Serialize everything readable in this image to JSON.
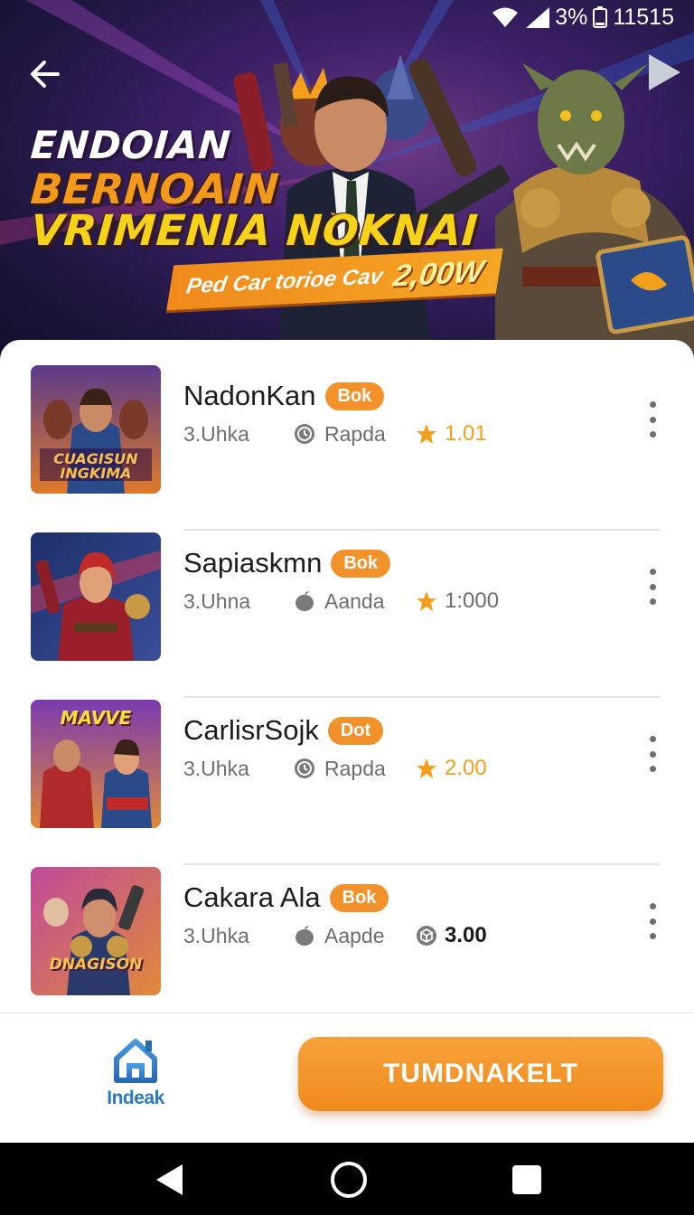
{
  "status_bar": {
    "battery": "3%",
    "time": "11515"
  },
  "header": {
    "back_icon": "arrow-left-icon"
  },
  "hero": {
    "line1": "ENDOIAN",
    "line2": "BERNOAIN",
    "line3": "VRIMENIA NOKNAI",
    "promo_text": "Ped Car torioe Cav",
    "promo_amount": "2,00W"
  },
  "games": [
    {
      "name": "NadonKan",
      "badge": "Bok",
      "meta_a": "3.Uhka",
      "meta_b": "Rapda",
      "meta_b_icon": "clock-icon",
      "rating": "1.01",
      "rating_icon": "star-icon",
      "thumb_text": "CUAGISUN INGKIMA"
    },
    {
      "name": "Sapiaskmn",
      "badge": "Bok",
      "meta_a": "3.Uhna",
      "meta_b": "Aanda",
      "meta_b_icon": "fruit-icon",
      "rating": "1:000",
      "rating_icon": "star-icon",
      "thumb_text": ""
    },
    {
      "name": "CarlisrSojk",
      "badge": "Dot",
      "meta_a": "3.Uhka",
      "meta_b": "Rapda",
      "meta_b_icon": "clock-icon",
      "rating": "2.00",
      "rating_icon": "star-icon",
      "thumb_text": "MAVVE"
    },
    {
      "name": "Cakara Ala",
      "badge": "Bok",
      "meta_a": "3.Uhka",
      "meta_b": "Aapde",
      "meta_b_icon": "fruit-icon",
      "rating": "3.00",
      "rating_icon": "cube-icon",
      "thumb_text": "DNAGISON"
    }
  ],
  "bottom_bar": {
    "home_label": "Indeak",
    "cta_label": "TUMDNAKELT"
  },
  "colors": {
    "accent": "#f3922a",
    "star": "#f2a01c",
    "home": "#2a7ac0"
  }
}
